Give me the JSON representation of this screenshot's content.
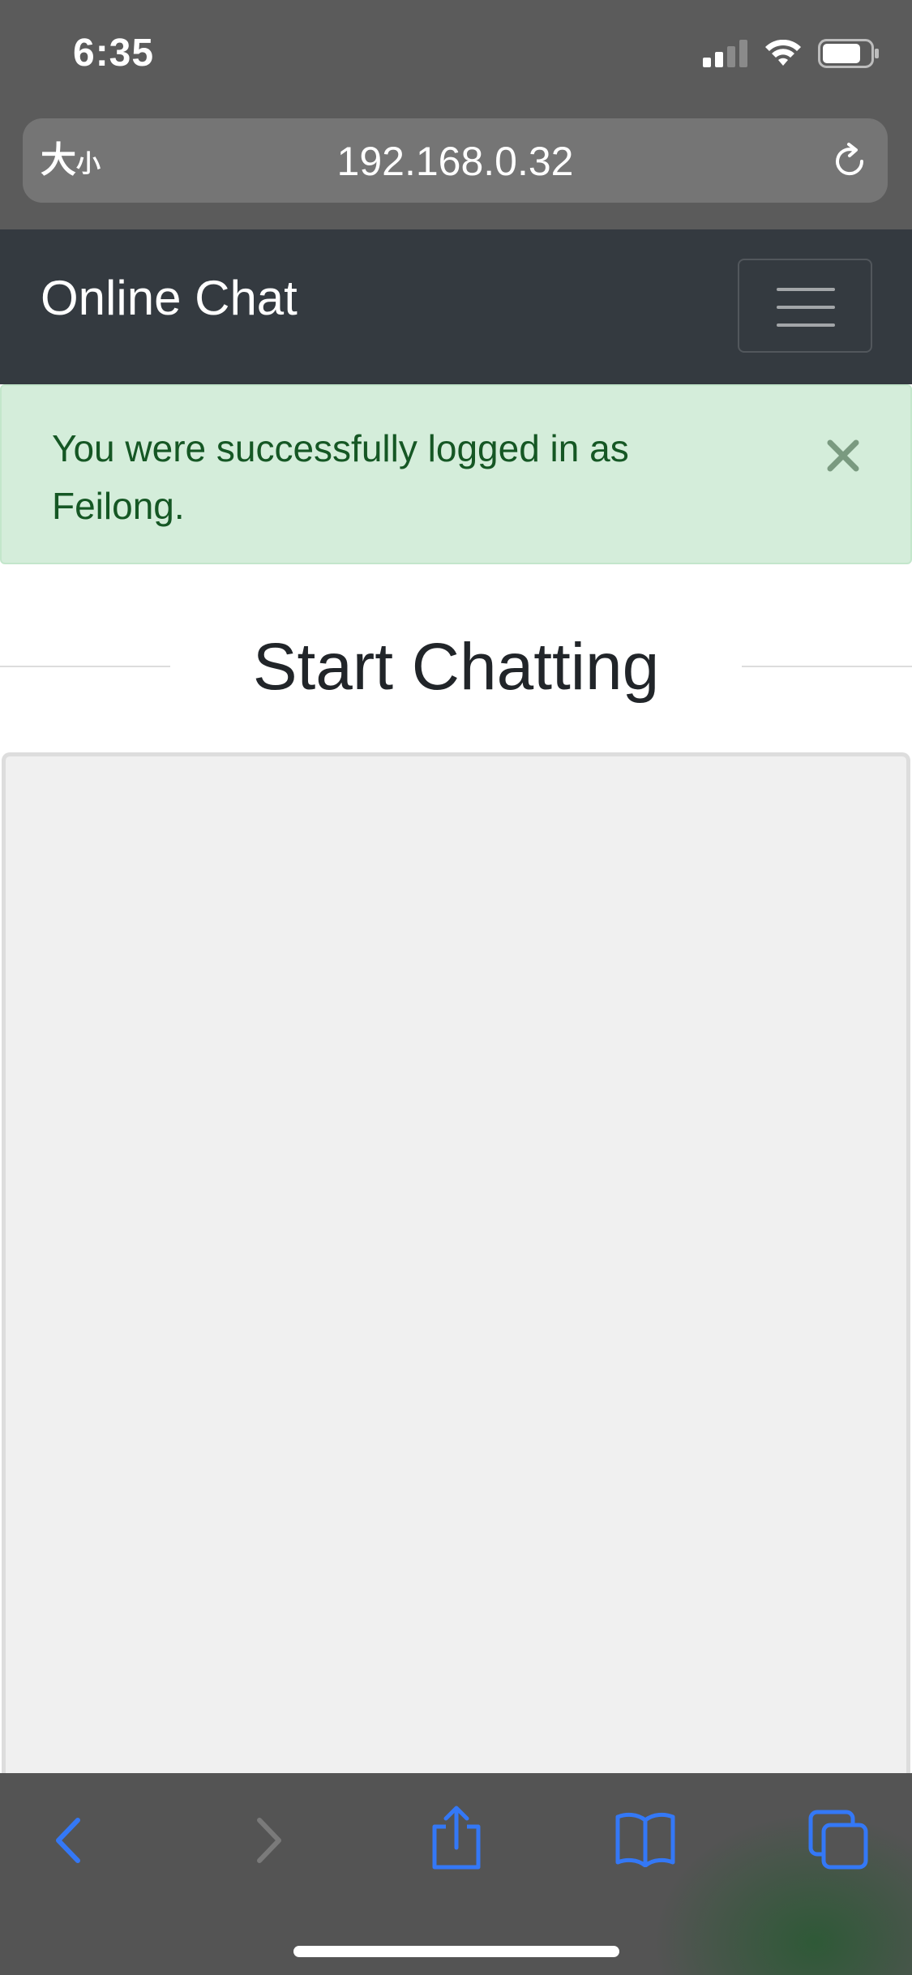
{
  "status_bar": {
    "time": "6:35"
  },
  "browser": {
    "text_size_big": "大",
    "text_size_small": "小",
    "url": "192.168.0.32"
  },
  "navbar": {
    "brand": "Online Chat"
  },
  "alert": {
    "message": "You were successfully logged in as Feilong."
  },
  "main": {
    "heading": "Start Chatting"
  },
  "icons": {
    "signal": "cellular-signal-icon",
    "wifi": "wifi-icon",
    "battery": "battery-icon",
    "reload": "reload-icon",
    "menu": "hamburger-menu-icon",
    "close": "close-icon",
    "back": "chevron-left-icon",
    "forward": "chevron-right-icon",
    "share": "share-icon",
    "bookmarks": "book-icon",
    "tabs": "tabs-icon"
  },
  "colors": {
    "navbar_bg": "#343a40",
    "alert_bg": "#d4edda",
    "alert_text": "#155724",
    "toolbar_accent": "#3478f6",
    "chat_bg": "#f0f0f0"
  }
}
